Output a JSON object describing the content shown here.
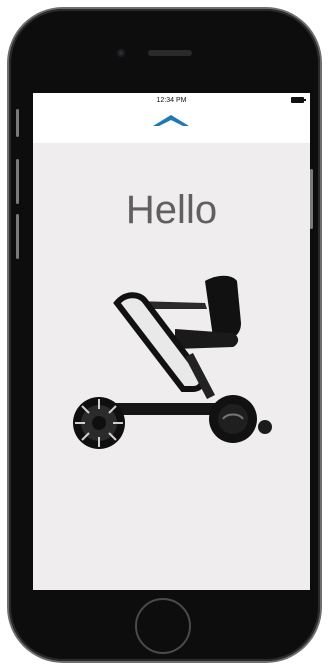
{
  "status_bar": {
    "time": "12:34 PM",
    "battery_icon": "battery-icon"
  },
  "nav": {
    "icon": "chevron-up-icon",
    "accent_color": "#1f78b4"
  },
  "main": {
    "greeting": "Hello",
    "image_icon": "wheelchair-icon"
  },
  "device": {
    "home_button_icon": "home-button-icon"
  }
}
